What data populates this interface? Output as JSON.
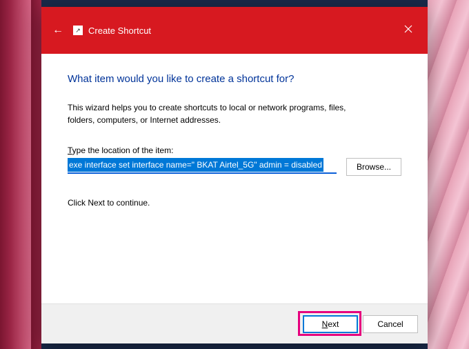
{
  "titlebar": {
    "title": "Create Shortcut"
  },
  "heading": "What item would you like to create a shortcut for?",
  "description": "This wizard helps you to create shortcuts to local or network programs, files, folders, computers, or Internet addresses.",
  "field": {
    "label_prefix": "T",
    "label_rest": "ype the location of the item:",
    "value": "exe interface set interface name=\" BKAT Airtel_5G\" admin = disabled",
    "browse_label": "Browse..."
  },
  "continue_text": "Click Next to continue.",
  "footer": {
    "next_underline": "N",
    "next_rest": "ext",
    "cancel_label": "Cancel"
  }
}
